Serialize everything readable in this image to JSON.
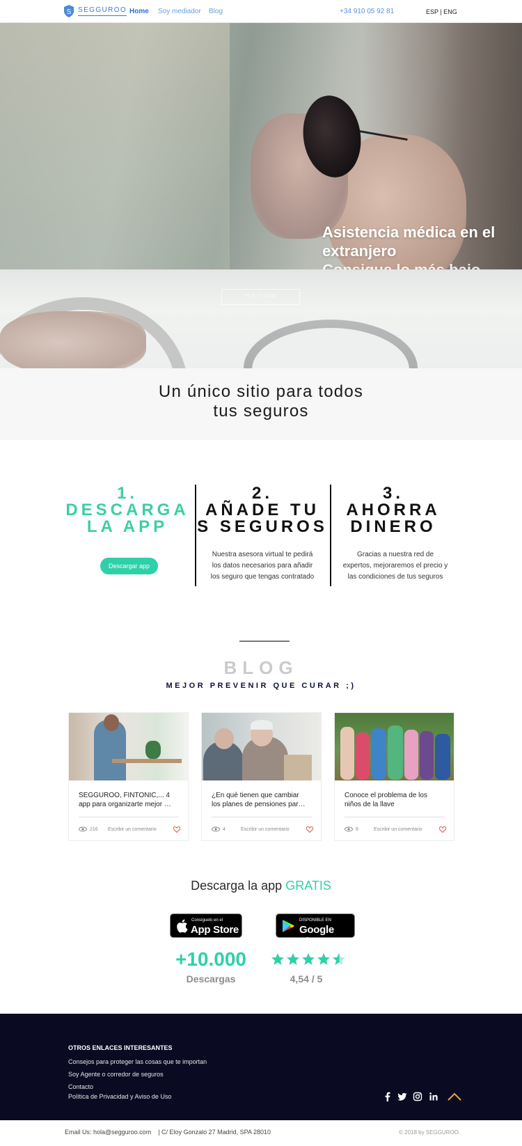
{
  "header": {
    "brand": "SEGGUROO",
    "nav": [
      "Home",
      "Soy mediador",
      "Blog"
    ],
    "phone": "+34 910 05 92 81",
    "language": "ESP | ENG"
  },
  "hero": {
    "caption": "Asistencia médica en el extranjero",
    "next_caption": "Consigue lo más bajo",
    "play_button": "VER VIDEO"
  },
  "tagline": {
    "line1": "Un único sitio para todos",
    "line2": "tus seguros"
  },
  "steps": [
    {
      "number": "1.",
      "title_line1": "DESCARGA",
      "title_line2": "LA APP",
      "button": "Descargar app",
      "color": "#3ccfa4"
    },
    {
      "number": "2.",
      "title_line1": "AÑADE TU",
      "title_line2": "S SEGUROS",
      "description": [
        "Nuestra asesora virtual te pedirá",
        "los datos necesarios para añadir",
        "los seguro que tengas contratado"
      ],
      "color": "#111111"
    },
    {
      "number": "3.",
      "title_line1": "AHORRA",
      "title_line2": "DINERO",
      "description": [
        "Gracias a nuestra red de",
        "expertos, mejoraremos el precio y",
        "las condiciones de tus seguros"
      ],
      "color": "#111111"
    }
  ],
  "blog": {
    "title": "BLOG",
    "subtitle": "MEJOR PREVENIR QUE CURAR ;)",
    "posts": [
      {
        "title_line1": "SEGGUROO, FINTONIC,... 4",
        "title_line2": "app para organizarte mejor …",
        "views": "216",
        "comment": "Escribir un comentario",
        "image": "man-at-laptop"
      },
      {
        "title_line1": "¿En qué tienen que cambiar",
        "title_line2": "los planes de pensiones par…",
        "views": "4",
        "comment": "Escribir un comentario",
        "image": "elderly-people-laughing"
      },
      {
        "title_line1": "Conoce el problema de los",
        "title_line2": "niños de la llave",
        "views": "8",
        "comment": "Escribir un comentario",
        "image": "group-of-children"
      }
    ]
  },
  "app": {
    "heading_prefix": "Descarga la app",
    "heading_highlight": "GRATIS",
    "app_store_small": "Consíguelo en el",
    "app_store_big": "App Store",
    "google_small": "DISPONIBLE EN",
    "google_big": "Google Play",
    "downloads": "+10.000",
    "downloads_label": "Descargas",
    "rating": "4,54 / 5",
    "stars": 4.54,
    "accent": "#2fd0a8"
  },
  "footer": {
    "heading": "OTROS ENLACES INTERESANTES",
    "links": [
      "Consejos para proteger las cosas que te importan",
      "Soy Agente o corredor de seguros",
      "Contacto",
      "Política de Privacidad y Aviso de Uso"
    ],
    "social": [
      "facebook-icon",
      "twitter-icon",
      "instagram-icon",
      "linkedin-icon"
    ],
    "email": "Email Us: hola@segguroo.com",
    "address": "|  C/ Eloy Gonzalo 27 Madrid, SPA 28010",
    "copyright": "© 2018 by SEGGUROO."
  }
}
